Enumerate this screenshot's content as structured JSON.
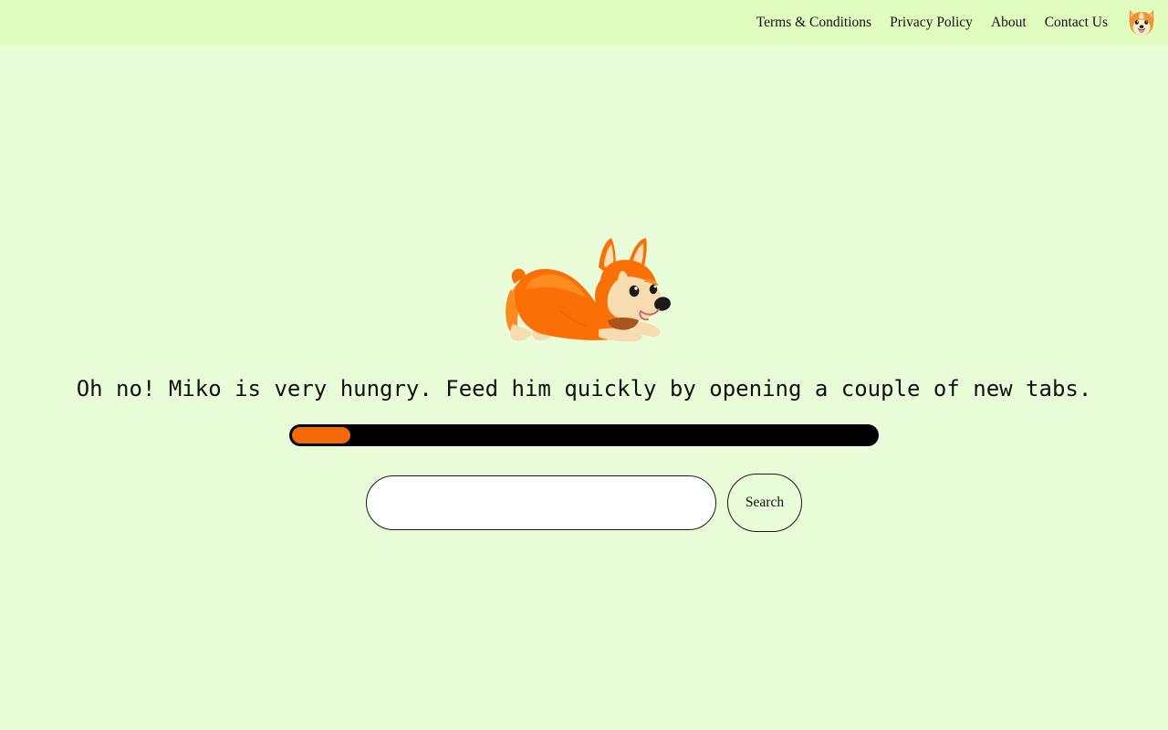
{
  "page": {
    "background_color": "#e8fdd8",
    "header_background_color": "#e0fcbe",
    "accent_color": "#f26a09",
    "track_color": "#000000"
  },
  "header": {
    "nav_items": [
      {
        "label": "Terms & Conditions",
        "name": "nav-terms-and-conditions"
      },
      {
        "label": "Privacy Policy",
        "name": "nav-privacy-policy"
      },
      {
        "label": "About",
        "name": "nav-about"
      },
      {
        "label": "Contact Us",
        "name": "nav-contact-us"
      }
    ],
    "logo": {
      "icon": "corgi-face-icon",
      "alt": "Miko corgi logo"
    }
  },
  "main": {
    "mascot": {
      "icon": "corgi-dog-illustration",
      "name": "Miko",
      "pose": "play-bow",
      "colors": {
        "fur": "#fb7005",
        "fur_light": "#ff8a1f",
        "muzzle": "#f5d6a6",
        "inner_ear": "#fbdfb4",
        "nose": "#1a1a1a",
        "collar": "#a8541c"
      }
    },
    "message": "Oh no! Miko is very hungry. Feed him quickly by opening a couple of new tabs.",
    "hunger_bar": {
      "label": "hunger-progress",
      "percent": 10,
      "fill_color": "#f26a09",
      "track_color": "#000000"
    },
    "search": {
      "value": "",
      "placeholder": "",
      "button_label": "Search"
    }
  }
}
